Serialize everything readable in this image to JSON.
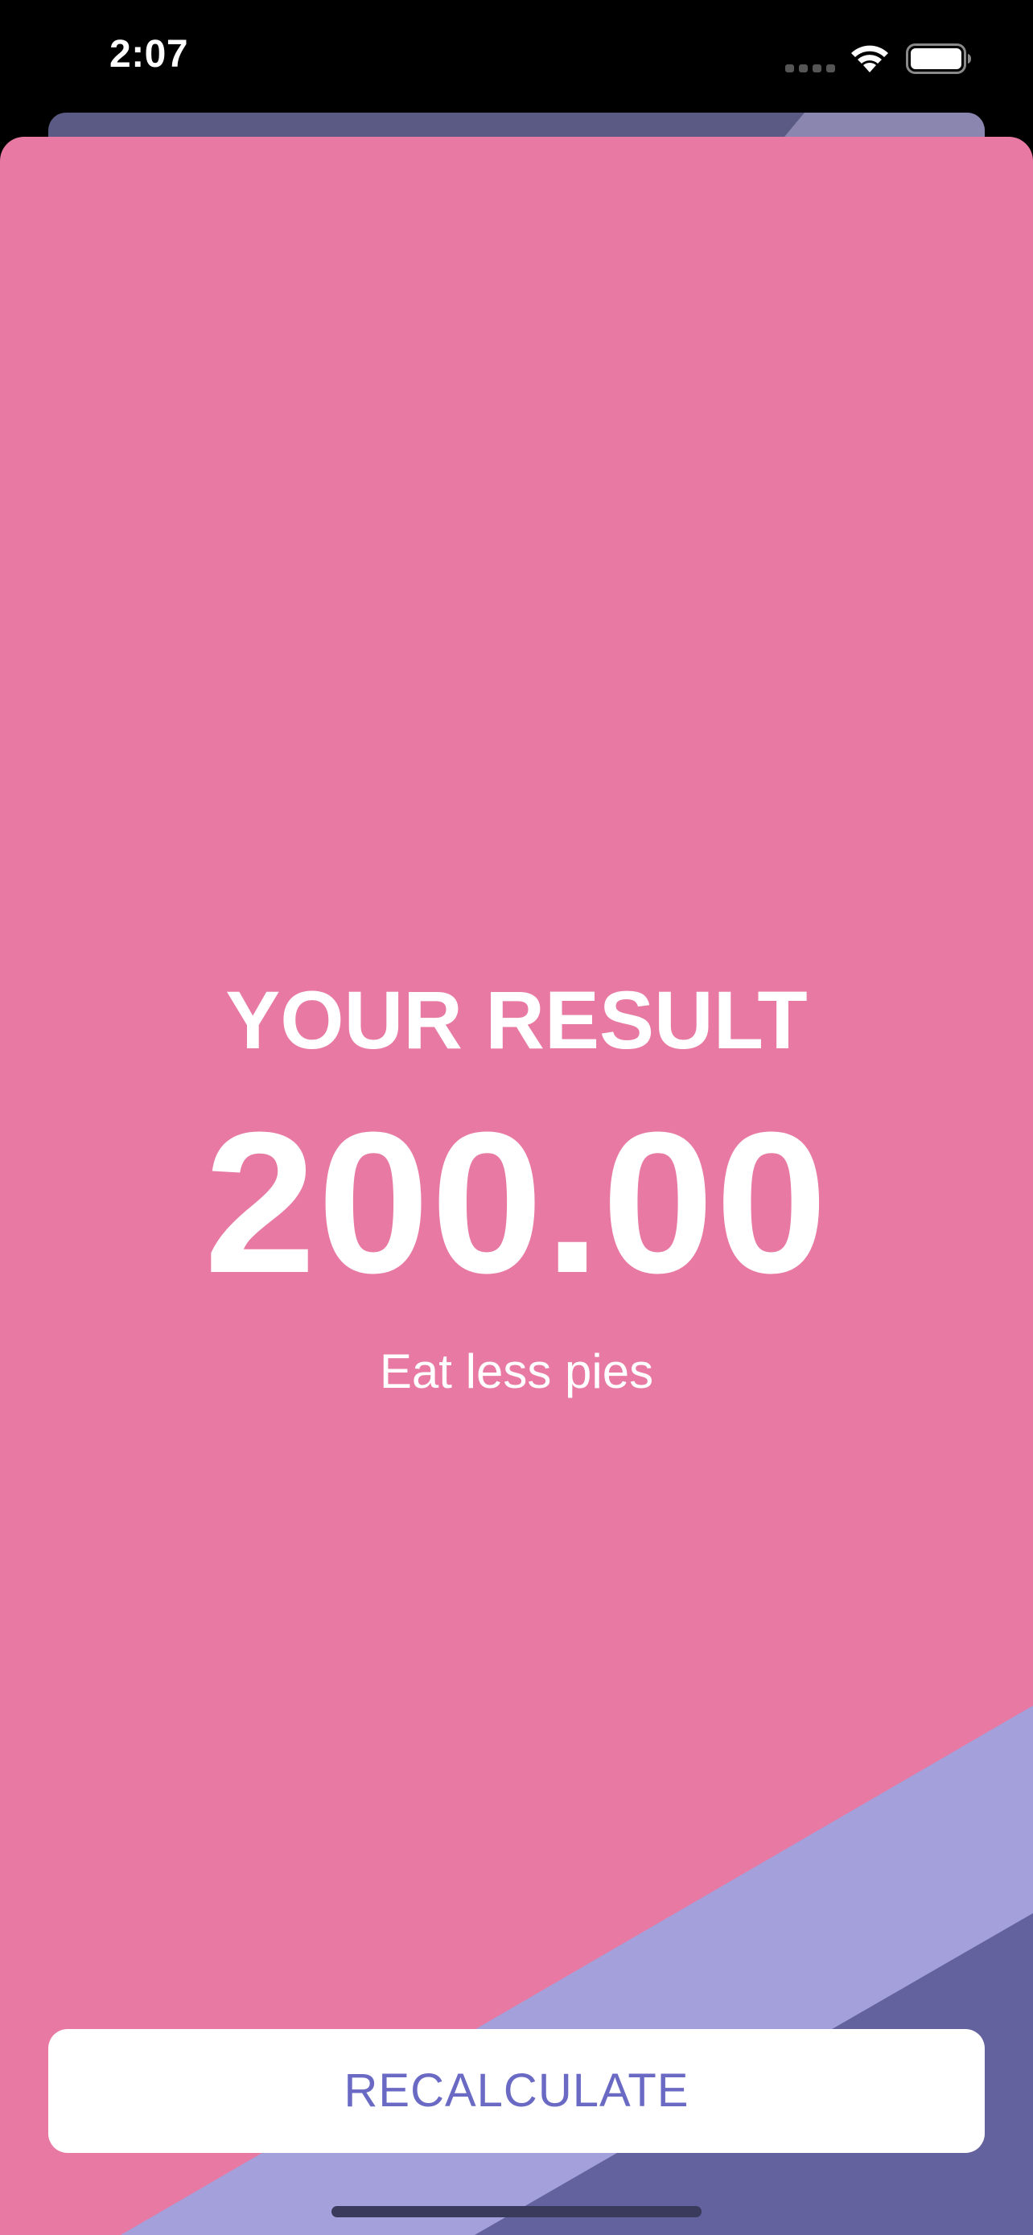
{
  "status_bar": {
    "time": "2:07",
    "icons": [
      "signal-icon",
      "wifi-icon",
      "battery-icon"
    ]
  },
  "result": {
    "title": "YOUR RESULT",
    "value": "200.00",
    "advice": "Eat less pies"
  },
  "actions": {
    "recalculate_label": "RECALCULATE"
  },
  "colors": {
    "background": "#e879a2",
    "back_sheet": "#5a5a84",
    "stripe_light": "#a3a0dc",
    "stripe_dark": "#64629e",
    "button_text": "#6a6ac4",
    "button_bg": "#ffffff"
  }
}
